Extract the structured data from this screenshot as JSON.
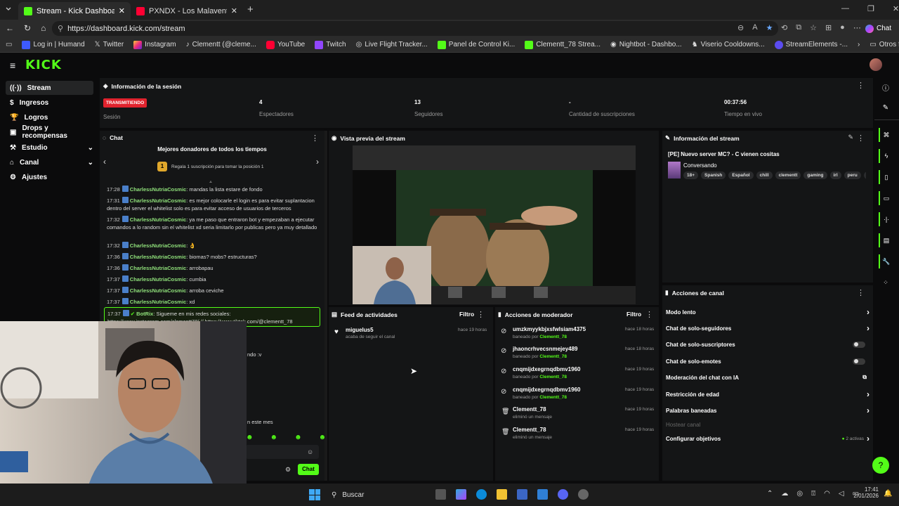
{
  "browser": {
    "tabs": [
      {
        "title": "Stream - Kick Dashboard",
        "active": true
      },
      {
        "title": "PXNDX - Los Malaventurados No L",
        "active": false
      }
    ],
    "url": "https://dashboard.kick.com/stream",
    "chat_button": "Chat",
    "bookmarks": [
      "Log in | Humand",
      "Twitter",
      "Instagram",
      "Clementt (@cleme...",
      "YouTube",
      "Twitch",
      "Live Flight Tracker...",
      "Panel de Control Ki...",
      "Clementt_78 Strea...",
      "Nightbot - Dashbo...",
      "Viserio Cooldowns...",
      "StreamElements -..."
    ],
    "other_favorites": "Otros favoritos"
  },
  "brand": {
    "logo": "KICK",
    "accent": "#53fc18"
  },
  "sidebar": {
    "items": [
      {
        "label": "Stream"
      },
      {
        "label": "Ingresos"
      },
      {
        "label": "Logros"
      },
      {
        "label": "Drops y recompensas"
      },
      {
        "label": "Estudio"
      },
      {
        "label": "Canal"
      },
      {
        "label": "Ajustes"
      }
    ]
  },
  "session": {
    "title": "Información de la sesión",
    "live_badge": "TRANSMITIENDO",
    "live_label": "Sesión",
    "viewers_value": "4",
    "viewers_label": "Espectadores",
    "followers_value": "13",
    "followers_label": "Seguidores",
    "subs_value": "-",
    "subs_label": "Cantidad de suscripciones",
    "time_value": "00:37:56",
    "time_label": "Tiempo en vivo"
  },
  "chat": {
    "title": "Chat",
    "donors_title": "Mejores donadores de todos los tiempos",
    "donor_rank": "1",
    "donor_hint": "Regala 1 suscripción para tomar la posición 1",
    "messages": [
      {
        "time": "17:28",
        "user": "CharlessNutriaCosmic",
        "text": "mandas la lista estare de fondo"
      },
      {
        "time": "17:31",
        "user": "CharlessNutriaCosmic",
        "text": "es mejor colocarle el login es para evitar suplantacion dentro del server el whitelist solo es para evitar acceso de usuarios de terceros"
      },
      {
        "time": "17:32",
        "user": "CharlessNutriaCosmic",
        "text": "ya me paso que entraron bot y empezaban a ejecutar comandos a lo random sin el whitelist xd seria limitarlo por publicas pero ya muy detallado"
      },
      {
        "time": "17:32",
        "user": "CharlessNutriaCosmic",
        "text": "👌"
      },
      {
        "time": "17:36",
        "user": "CharlessNutriaCosmic",
        "text": "biomas? mobs? estructuras?"
      },
      {
        "time": "17:36",
        "user": "CharlessNutriaCosmic",
        "text": "arrobapau"
      },
      {
        "time": "17:37",
        "user": "CharlessNutriaCosmic",
        "text": "cumbia"
      },
      {
        "time": "17:37",
        "user": "CharlessNutriaCosmic",
        "text": "arroba ceviche"
      },
      {
        "time": "17:37",
        "user": "CharlessNutriaCosmic",
        "text": "xd"
      }
    ],
    "highlight": {
      "time": "17:37",
      "user": "BotRix",
      "text": "Sigueme en mis redes sociales: https://www.instagram.com/clementt78/ // https://www.tiktok.com/@clementt_78"
    },
    "partial_1": "ndo :v",
    "partial_2": "n este mes",
    "send_button": "Chat"
  },
  "preview": {
    "title": "Vista previa del stream"
  },
  "stream_info": {
    "title": "Información del stream",
    "stream_title": "[PE] Nuevo server MC? - C vienen cositas",
    "category": "Conversando",
    "tags": [
      "18+",
      "Spanish",
      "Español",
      "chill",
      "clementt",
      "gaming",
      "irl",
      "peru",
      "per"
    ]
  },
  "activity": {
    "title": "Feed de actividades",
    "filter": "Filtro",
    "items": [
      {
        "user": "miguelus5",
        "action": "acaba de seguir el canal",
        "time": "hace 19 horas"
      }
    ]
  },
  "moderator": {
    "title": "Acciones de moderador",
    "filter": "Filtro",
    "items": [
      {
        "user": "umzkmyykbjxsfwlsiam4375",
        "action": "baneado por",
        "by": "Clementt_78",
        "time": "hace 18 horas",
        "icon": "ban-icon"
      },
      {
        "user": "jhaoncrhvecsnmejey489",
        "action": "baneado por",
        "by": "Clementt_78",
        "time": "hace 18 horas",
        "icon": "ban-icon"
      },
      {
        "user": "cnqmijdxegrnqdbmv1960",
        "action": "baneado por",
        "by": "Clementt_78",
        "time": "hace 19 horas",
        "icon": "ban-icon"
      },
      {
        "user": "cnqmijdxegrnqdbmv1960",
        "action": "baneado por",
        "by": "Clementt_78",
        "time": "hace 19 horas",
        "icon": "ban-icon"
      },
      {
        "user": "Clementt_78",
        "action": "eliminó un mensaje",
        "by": "",
        "time": "hace 19 horas",
        "icon": "trash-icon"
      },
      {
        "user": "Clementt_78",
        "action": "eliminó un mensaje",
        "by": "",
        "time": "hace 19 horas",
        "icon": "trash-icon"
      }
    ]
  },
  "channel_actions": {
    "title": "Acciones de canal",
    "items": [
      {
        "label": "Modo lento",
        "control": "arrow"
      },
      {
        "label": "Chat de solo-seguidores",
        "control": "arrow"
      },
      {
        "label": "Chat de solo-suscriptores",
        "control": "toggle"
      },
      {
        "label": "Chat de solo-emotes",
        "control": "toggle"
      },
      {
        "label": "Moderación del chat con IA",
        "control": "external"
      },
      {
        "label": "Restricción de edad",
        "control": "arrow"
      },
      {
        "label": "Palabras baneadas",
        "control": "arrow"
      },
      {
        "label": "Hostear canal",
        "control": "none"
      },
      {
        "label": "Configurar objetivos",
        "control": "arrow",
        "badge": "2 activas"
      }
    ]
  },
  "taskbar": {
    "search": "Buscar",
    "time": "17:41",
    "date": "2/01/2026"
  }
}
